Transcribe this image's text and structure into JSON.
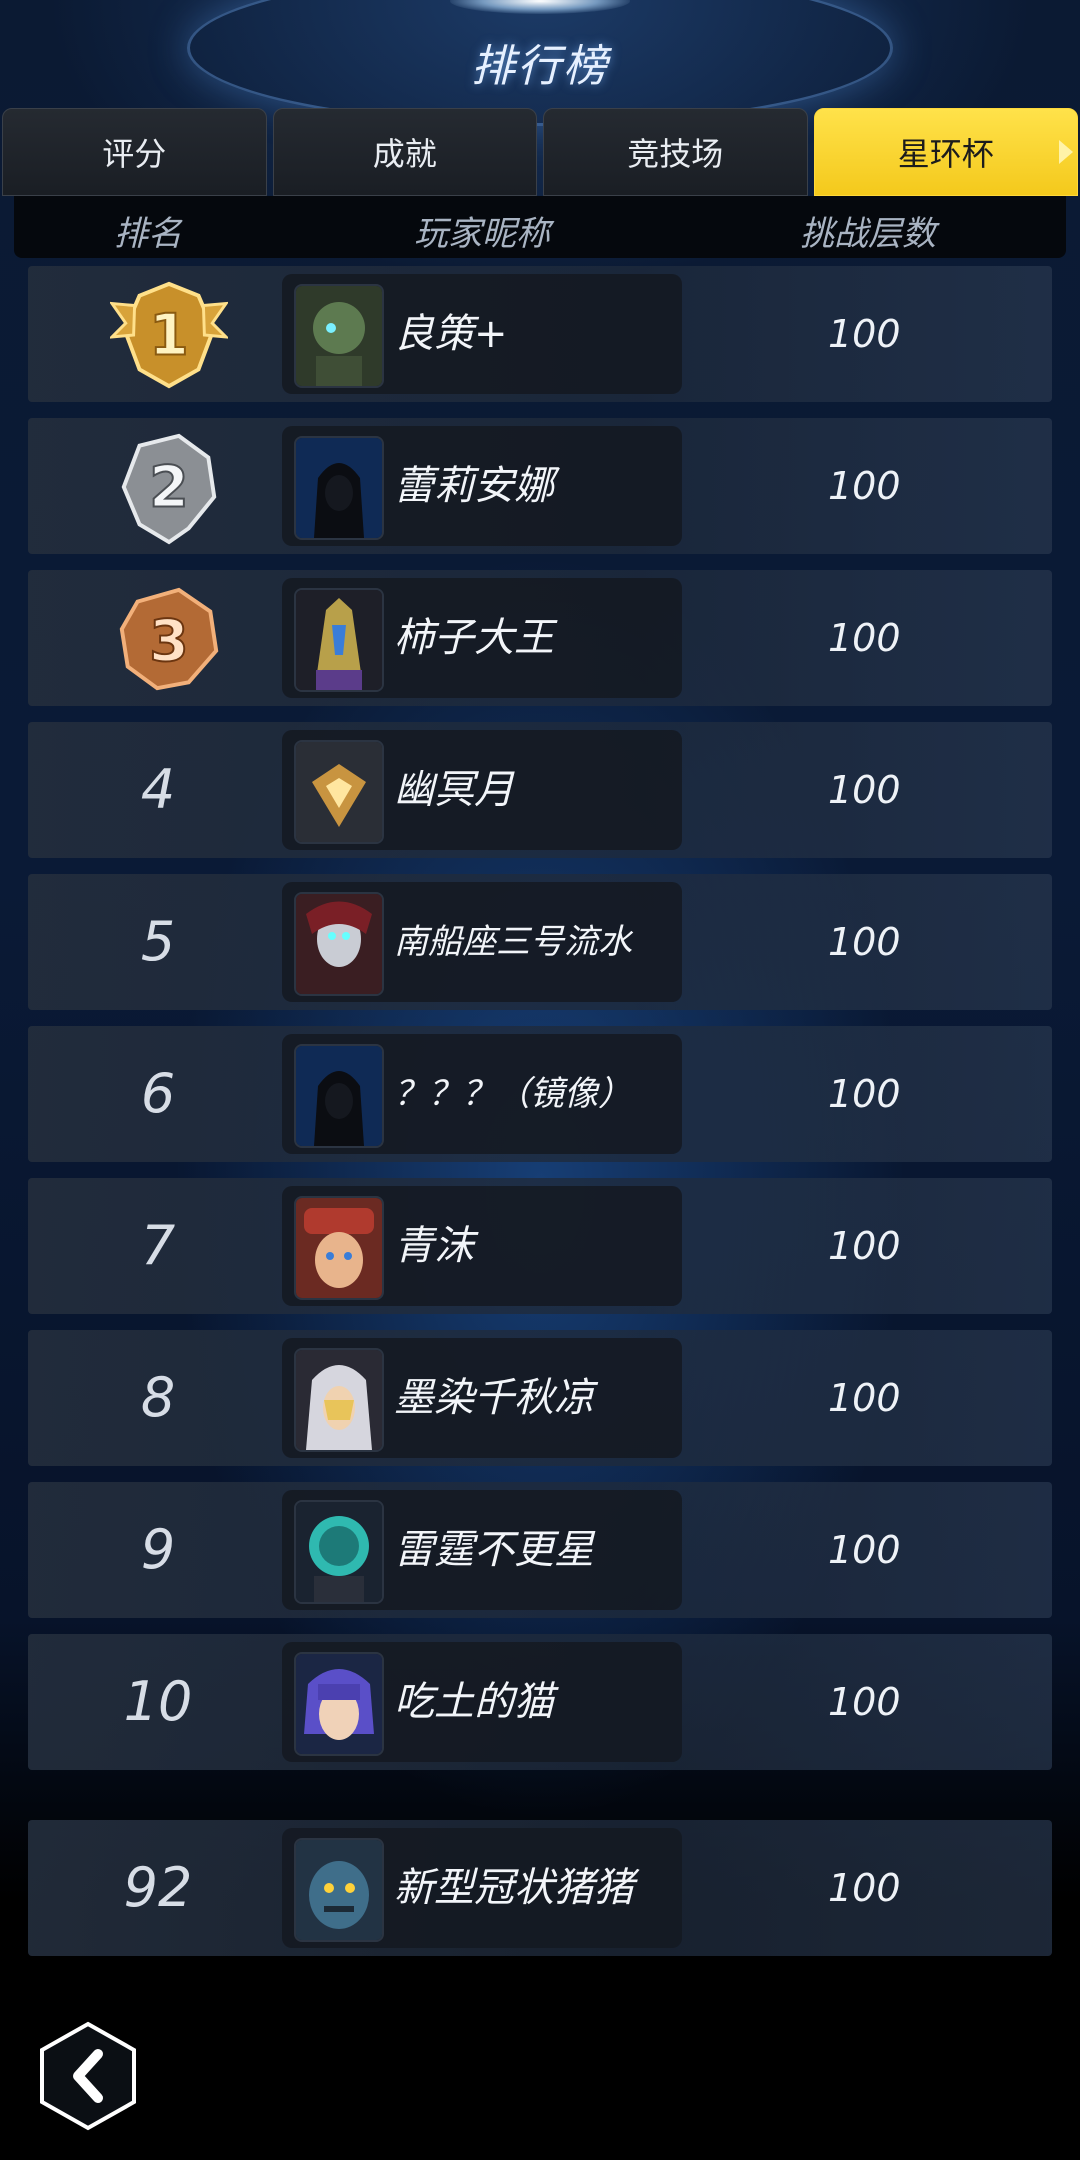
{
  "page_title": "排行榜",
  "tabs": [
    {
      "label": "评分",
      "active": false
    },
    {
      "label": "成就",
      "active": false
    },
    {
      "label": "竞技场",
      "active": false
    },
    {
      "label": "星环杯",
      "active": true
    }
  ],
  "columns": {
    "rank": "排名",
    "player": "玩家昵称",
    "floors": "挑战层数"
  },
  "rows": [
    {
      "rank": "1",
      "medal": "gold-medal-icon",
      "name": "良策+",
      "score": "100"
    },
    {
      "rank": "2",
      "medal": "silver-medal-icon",
      "name": "蕾莉安娜",
      "score": "100"
    },
    {
      "rank": "3",
      "medal": "bronze-medal-icon",
      "name": "柿子大王",
      "score": "100"
    },
    {
      "rank": "4",
      "name": "幽冥月",
      "score": "100"
    },
    {
      "rank": "5",
      "name": "南船座三号流水",
      "score": "100"
    },
    {
      "rank": "6",
      "name": "？？？（镜像）",
      "score": "100"
    },
    {
      "rank": "7",
      "name": "青沫",
      "score": "100"
    },
    {
      "rank": "8",
      "name": "墨染千秋凉",
      "score": "100"
    },
    {
      "rank": "9",
      "name": "雷霆不更星",
      "score": "100"
    },
    {
      "rank": "10",
      "name": "吃土的猫",
      "score": "100"
    }
  ],
  "my_row": {
    "rank": "92",
    "name": "新型冠状猪猪",
    "score": "100"
  },
  "colors": {
    "accent_tab": "#f4c91c",
    "background": "#0a1a36"
  }
}
